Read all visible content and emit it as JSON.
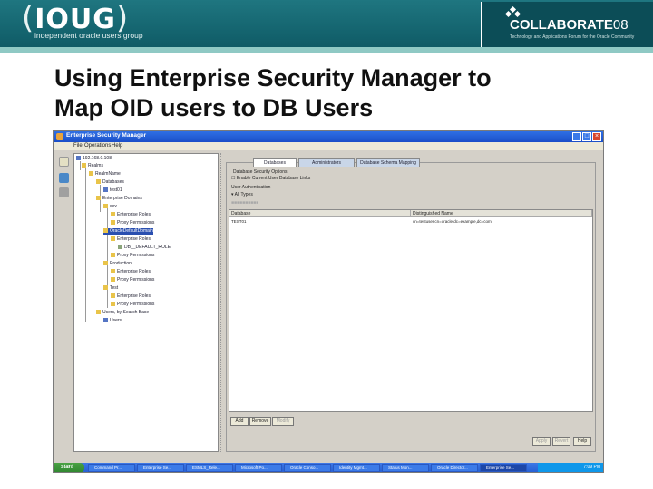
{
  "header": {
    "logo_main": "IOUG",
    "logo_sub": "independent oracle users group",
    "collab_name": "COLLABORATE",
    "collab_num": "08",
    "collab_tagline": "Technology and Applications Forum for the Oracle Community"
  },
  "slide": {
    "title": "Using Enterprise Security Manager to\nMap OID users to DB Users"
  },
  "window": {
    "title": "Enterprise Security Manager",
    "menu": [
      "File",
      "Operations",
      "Help"
    ],
    "window_buttons": [
      "_",
      "□",
      "×"
    ]
  },
  "tree": {
    "nodes": [
      "192.168.0.108",
      "Realms",
      "RealmName",
      "Databases",
      "test01",
      "Enterprise Domains",
      "dev",
      "Enterprise Roles",
      "Proxy Permissions",
      "OracleDefaultDomain",
      "Enterprise Roles",
      "DB__DEFAULT_ROLE",
      "Proxy Permissions",
      "Production",
      "Enterprise Roles",
      "Proxy Permissions",
      "Test",
      "Enterprise Roles",
      "Proxy Permissions",
      "Users, by Search Base",
      "Users"
    ]
  },
  "panel": {
    "tabs": [
      "Databases",
      "Administrators",
      "Database Schema Mapping"
    ],
    "group_label": "Database Security Options",
    "checkbox_label": "Enable Current User Database Links",
    "auth_label": "User Authentication",
    "auth_value": "All Types",
    "table_headers": [
      "Database",
      "Distinguished Name"
    ],
    "table_rows": [
      {
        "database": "TEST01",
        "dn": "cn=testuser,cn=oracle,dc=example,dc=com"
      }
    ],
    "buttons": [
      "Add",
      "Remove",
      "Modify"
    ],
    "footer_buttons": [
      "Apply",
      "Revert",
      "Help"
    ]
  },
  "taskbar": {
    "start": "start",
    "tasks": [
      "Command Pr...",
      "Enterprise Se...",
      "ESMLS_Rele...",
      "Microsoft Po...",
      "Oracle Conso...",
      "Identity Mgmt...",
      "Status Mon...",
      "Oracle Director...",
      "Enterprise Se..."
    ],
    "clock": "7:09 PM"
  }
}
